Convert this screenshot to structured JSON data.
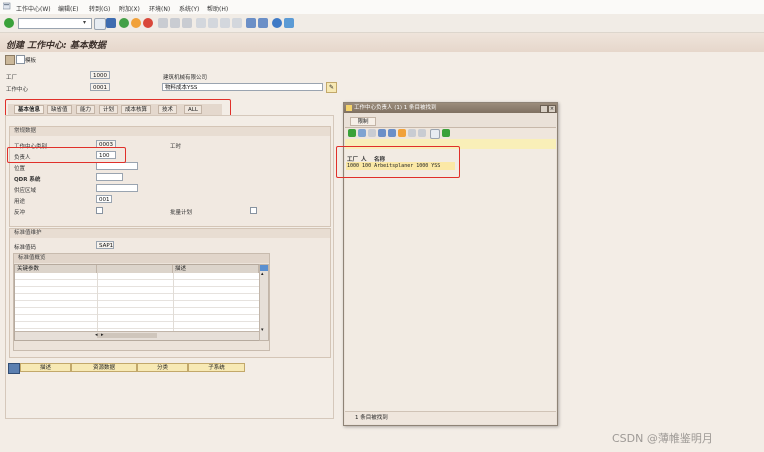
{
  "menubar": {
    "items": [
      "工作中心(W)",
      "编辑(E)",
      "转到(G)",
      "附加(X)",
      "环境(N)",
      "系统(Y)",
      "帮助(H)"
    ]
  },
  "toolbar": {
    "command_value": ""
  },
  "title": "创建 工作中心: 基本数据",
  "appbar": {
    "button_label": "模板"
  },
  "header": {
    "plant_label": "工厂",
    "plant_value": "1000",
    "plant_desc": "建筑机械有限公司",
    "wc_label": "工作中心",
    "wc_value": "0001",
    "wc_desc": "物料成本YSS"
  },
  "tabs": [
    "基本信息",
    "缺省值",
    "能力",
    "计划",
    "成本核算",
    "技术",
    "ALL"
  ],
  "general": {
    "title": "常规数据",
    "category_label": "工作中心类别",
    "category_value": "0003",
    "person_label": "负责人",
    "person_value": "100",
    "location_label": "位置",
    "qdr_label": "QDR 系统",
    "supply_label": "供应区域",
    "usage_label": "用途",
    "usage_value": "001",
    "backflush_label": "反冲",
    "tool_label": "工时",
    "advanced_label": "批量计划"
  },
  "standard": {
    "title": "标准值维护",
    "key_label": "标准值码",
    "key_value": "SAP1",
    "overview_title": "标准值概览",
    "col_param": "关键参数",
    "col_desc": "描述"
  },
  "bottom_buttons": [
    "描述",
    "资源数据",
    "分类",
    "子系统"
  ],
  "popup": {
    "title": "工作中心负责人 (1)   1 条目被找到",
    "tab": "限制",
    "col_plant": "工厂",
    "col_person": "人",
    "col_name": "名称",
    "row": "1000 100 Arbeitsplaner  1000  YSS",
    "status": "1 条目被找到"
  },
  "watermark": "CSDN @薄帷鉴明月"
}
